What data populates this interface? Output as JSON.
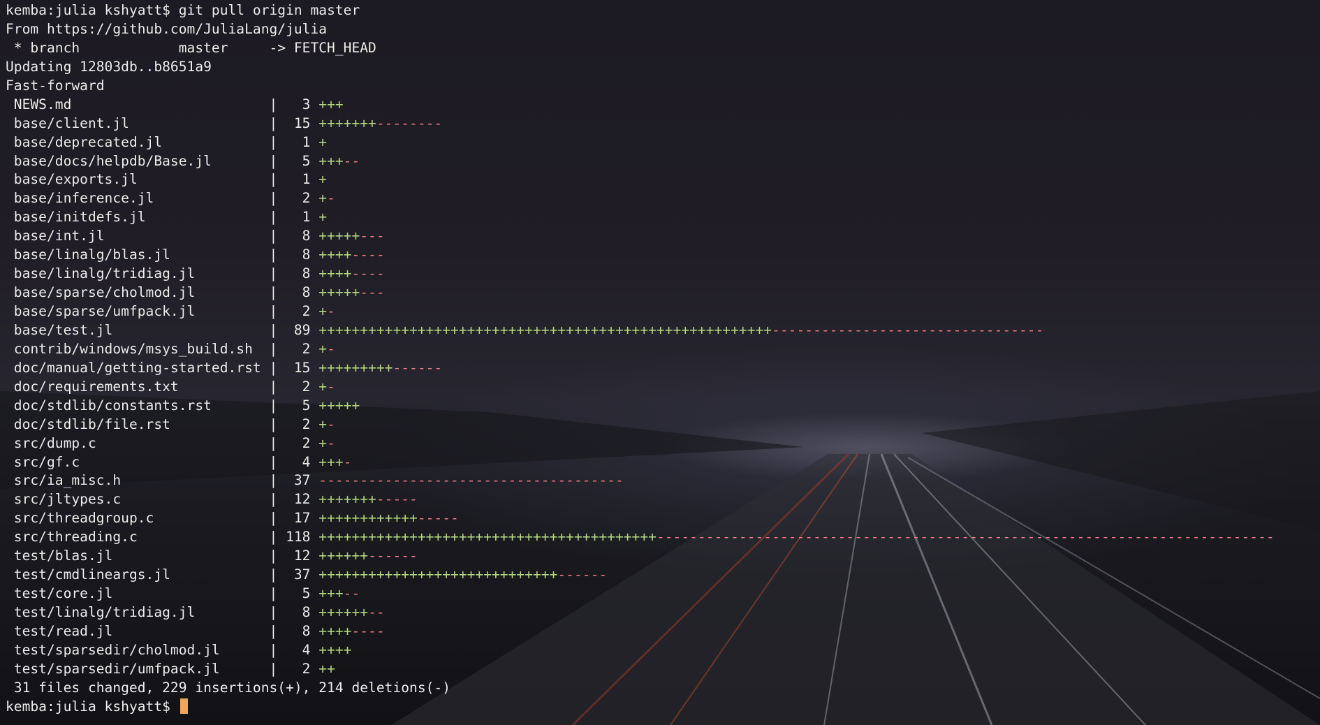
{
  "window": {
    "type": "terminal"
  },
  "colors": {
    "text": "#eeeeee",
    "insertions": "#b5d681",
    "deletions": "#f07f83",
    "cursor": "#f2a45a"
  },
  "session": {
    "prompt": "kemba:julia kshyatt$",
    "command": "git pull origin master",
    "from_line": "From https://github.com/JuliaLang/julia",
    "branch_line": " * branch            master     -> FETCH_HEAD",
    "updating_line": "Updating 12803db..b8651a9",
    "fast_forward_line": "Fast-forward",
    "summary": " 31 files changed, 229 insertions(+), 214 deletions(-)",
    "final_prompt": "kemba:julia kshyatt$ "
  },
  "diffstat": [
    {
      "file": "NEWS.md",
      "count": "3",
      "plus": "+++",
      "minus": ""
    },
    {
      "file": "base/client.jl",
      "count": "15",
      "plus": "+++++++",
      "minus": "--------"
    },
    {
      "file": "base/deprecated.jl",
      "count": "1",
      "plus": "+",
      "minus": ""
    },
    {
      "file": "base/docs/helpdb/Base.jl",
      "count": "5",
      "plus": "+++",
      "minus": "--"
    },
    {
      "file": "base/exports.jl",
      "count": "1",
      "plus": "+",
      "minus": ""
    },
    {
      "file": "base/inference.jl",
      "count": "2",
      "plus": "+",
      "minus": "-"
    },
    {
      "file": "base/initdefs.jl",
      "count": "1",
      "plus": "+",
      "minus": ""
    },
    {
      "file": "base/int.jl",
      "count": "8",
      "plus": "+++++",
      "minus": "---"
    },
    {
      "file": "base/linalg/blas.jl",
      "count": "8",
      "plus": "++++",
      "minus": "----"
    },
    {
      "file": "base/linalg/tridiag.jl",
      "count": "8",
      "plus": "++++",
      "minus": "----"
    },
    {
      "file": "base/sparse/cholmod.jl",
      "count": "8",
      "plus": "+++++",
      "minus": "---"
    },
    {
      "file": "base/sparse/umfpack.jl",
      "count": "2",
      "plus": "+",
      "minus": "-"
    },
    {
      "file": "base/test.jl",
      "count": "89",
      "plus": "+++++++++++++++++++++++++++++++++++++++++++++++++++++++",
      "minus": "---------------------------------"
    },
    {
      "file": "contrib/windows/msys_build.sh",
      "count": "2",
      "plus": "+",
      "minus": "-"
    },
    {
      "file": "doc/manual/getting-started.rst",
      "count": "15",
      "plus": "+++++++++",
      "minus": "------"
    },
    {
      "file": "doc/requirements.txt",
      "count": "2",
      "plus": "+",
      "minus": "-"
    },
    {
      "file": "doc/stdlib/constants.rst",
      "count": "5",
      "plus": "+++++",
      "minus": ""
    },
    {
      "file": "doc/stdlib/file.rst",
      "count": "2",
      "plus": "+",
      "minus": "-"
    },
    {
      "file": "src/dump.c",
      "count": "2",
      "plus": "+",
      "minus": "-"
    },
    {
      "file": "src/gf.c",
      "count": "4",
      "plus": "+++",
      "minus": "-"
    },
    {
      "file": "src/ia_misc.h",
      "count": "37",
      "plus": "",
      "minus": "-------------------------------------"
    },
    {
      "file": "src/jltypes.c",
      "count": "12",
      "plus": "+++++++",
      "minus": "-----"
    },
    {
      "file": "src/threadgroup.c",
      "count": "17",
      "plus": "++++++++++++",
      "minus": "-----"
    },
    {
      "file": "src/threading.c",
      "count": "118",
      "plus": "+++++++++++++++++++++++++++++++++++++++++",
      "minus": "---------------------------------------------------------------------------"
    },
    {
      "file": "test/blas.jl",
      "count": "12",
      "plus": "++++++",
      "minus": "------"
    },
    {
      "file": "test/cmdlineargs.jl",
      "count": "37",
      "plus": "+++++++++++++++++++++++++++++",
      "minus": "------"
    },
    {
      "file": "test/core.jl",
      "count": "5",
      "plus": "+++",
      "minus": "--"
    },
    {
      "file": "test/linalg/tridiag.jl",
      "count": "8",
      "plus": "++++++",
      "minus": "--"
    },
    {
      "file": "test/read.jl",
      "count": "8",
      "plus": "++++",
      "minus": "----"
    },
    {
      "file": "test/sparsedir/cholmod.jl",
      "count": "4",
      "plus": "++++",
      "minus": ""
    },
    {
      "file": "test/sparsedir/umfpack.jl",
      "count": "2",
      "plus": "++",
      "minus": ""
    }
  ]
}
